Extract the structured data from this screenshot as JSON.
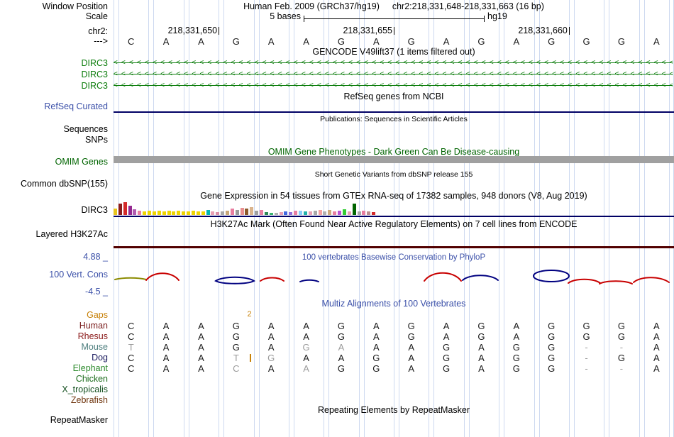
{
  "colors": {
    "guideline": "#cdd9f0",
    "gencode_green": "#0c7d0c",
    "track_blue": "#3a4fa8",
    "navy": "#000064",
    "dark_green": "#006400",
    "omim_bar": "#a0a0a0",
    "maroon_line": "#520000",
    "gaps_orange": "#c8820a",
    "cons_red": "#c80000",
    "cons_navy": "#000080",
    "cons_olive": "#8b8b00",
    "muted_letter": "#9b9b9b"
  },
  "header": {
    "window_position_label": "Window Position",
    "assembly": "Human Feb. 2009 (GRCh37/hg19)",
    "position": "chr2:218,331,648-218,331,663 (16 bp)",
    "scale_label": "Scale",
    "scale_value": "5 bases",
    "scale_assembly": "hg19",
    "chrom_label": "chr2:",
    "strand_label": "--->",
    "ruler_ticks": [
      {
        "text": "218,331,650",
        "boundary": 3
      },
      {
        "text": "218,331,655",
        "boundary": 8
      },
      {
        "text": "218,331,660",
        "boundary": 13
      }
    ],
    "sequence": [
      "C",
      "A",
      "A",
      "G",
      "A",
      "A",
      "G",
      "A",
      "G",
      "A",
      "G",
      "A",
      "G",
      "G",
      "G",
      "A"
    ]
  },
  "tracks": {
    "gencode": {
      "title": "GENCODE V49lift37 (1 items filtered out)",
      "transcripts": [
        "DIRC3",
        "DIRC3",
        "DIRC3"
      ]
    },
    "refseq": {
      "title": "RefSeq genes from NCBI",
      "label": "RefSeq Curated"
    },
    "publications": {
      "title": "Publications: Sequences in Scientific Articles",
      "labels": [
        "Sequences",
        "SNPs"
      ]
    },
    "omim": {
      "title": "OMIM Gene Phenotypes - Dark Green Can Be Disease-causing",
      "label": "OMIM Genes"
    },
    "dbsnp": {
      "title": "Short Genetic Variants from dbSNP release 155",
      "label": "Common dbSNP(155)"
    },
    "gtex": {
      "title": "Gene Expression in 54 tissues from GTEx RNA-seq of 17382 samples, 948 donors (V8, Aug 2019)",
      "label": "DIRC3",
      "bars": [
        [
          "#e8c41f",
          9
        ],
        [
          "#8b1c1c",
          16
        ],
        [
          "#d42a2a",
          18
        ],
        [
          "#94288f",
          13
        ],
        [
          "#b05bb0",
          8
        ],
        [
          "#e87ea0",
          6
        ],
        [
          "#efd500",
          5
        ],
        [
          "#efd500",
          6
        ],
        [
          "#efd500",
          5
        ],
        [
          "#efd500",
          6
        ],
        [
          "#efd500",
          5
        ],
        [
          "#efd500",
          6
        ],
        [
          "#efd500",
          5
        ],
        [
          "#efd500",
          6
        ],
        [
          "#efd500",
          5
        ],
        [
          "#efd500",
          5
        ],
        [
          "#efd500",
          6
        ],
        [
          "#efd500",
          5
        ],
        [
          "#efd500",
          5
        ],
        [
          "#00b5b5",
          7
        ],
        [
          "#e8a0b4",
          5
        ],
        [
          "#d98ea6",
          4
        ],
        [
          "#a8a8a8",
          5
        ],
        [
          "#c8a878",
          6
        ],
        [
          "#e87ea0",
          9
        ],
        [
          "#9a9a9a",
          7
        ],
        [
          "#e89090",
          10
        ],
        [
          "#8b5a2b",
          9
        ],
        [
          "#d9b38c",
          11
        ],
        [
          "#a0a0a0",
          6
        ],
        [
          "#e87ea0",
          7
        ],
        [
          "#2e8b57",
          4
        ],
        [
          "#3cb371",
          3
        ],
        [
          "#b0b0b0",
          3
        ],
        [
          "#e8a0b4",
          4
        ],
        [
          "#4169e1",
          5
        ],
        [
          "#9370db",
          4
        ],
        [
          "#e87ea0",
          6
        ],
        [
          "#87cefa",
          6
        ],
        [
          "#20b2aa",
          5
        ],
        [
          "#e8a0b4",
          5
        ],
        [
          "#a8a8a8",
          6
        ],
        [
          "#f4a0a0",
          7
        ],
        [
          "#b0b0b0",
          5
        ],
        [
          "#cdaa7d",
          7
        ],
        [
          "#e87ea0",
          5
        ],
        [
          "#ba55d3",
          6
        ],
        [
          "#32cd32",
          8
        ],
        [
          "#e8a0b4",
          5
        ],
        [
          "#006400",
          16
        ],
        [
          "#a8a8a8",
          5
        ],
        [
          "#e87ea0",
          6
        ],
        [
          "#bc8f8f",
          5
        ],
        [
          "#d42a2a",
          4
        ]
      ]
    },
    "h3k27ac": {
      "title": "H3K27Ac Mark (Often Found Near Active Regulatory Elements) on 7 cell lines from ENCODE",
      "label": "Layered H3K27Ac"
    },
    "conservation": {
      "title": "100 vertebrates Basewise Conservation by PhyloP",
      "label": "100 Vert. Cons",
      "max_label": "4.88 _",
      "min_label": "-4.5 _"
    },
    "multiz": {
      "title": "Multiz Alignments of 100 Vertebrates",
      "gaps": {
        "label": "Gaps",
        "items": [
          {
            "boundary": 4,
            "text": "2"
          }
        ]
      },
      "species": [
        {
          "name": "Human",
          "color": "#7c2020",
          "cells": [
            "C",
            "A",
            "A",
            "G",
            "A",
            "A",
            "G",
            "A",
            "G",
            "A",
            "G",
            "A",
            "G",
            "G",
            "G",
            "A"
          ],
          "muted": []
        },
        {
          "name": "Rhesus",
          "color": "#8b1a1a",
          "cells": [
            "C",
            "A",
            "A",
            "G",
            "A",
            "A",
            "G",
            "A",
            "G",
            "A",
            "G",
            "A",
            "G",
            "G",
            "G",
            "A"
          ],
          "muted": []
        },
        {
          "name": "Mouse",
          "color": "#4d7e7e",
          "cells": [
            "T",
            "A",
            "A",
            "G",
            "A",
            "G",
            "A",
            "A",
            "A",
            "G",
            "A",
            "G",
            "G",
            "-",
            "-",
            "A"
          ],
          "muted": [
            0,
            5,
            6,
            13,
            14
          ]
        },
        {
          "name": "Dog",
          "color": "#1a1a5e",
          "cells": [
            "C",
            "A",
            "A",
            "T",
            "G",
            "A",
            "A",
            "G",
            "A",
            "G",
            "A",
            "G",
            "G",
            "-",
            "G",
            "A"
          ],
          "muted": [
            3,
            4,
            13
          ],
          "insert_boundary": 4
        },
        {
          "name": "Elephant",
          "color": "#2e8b2e",
          "cells": [
            "C",
            "A",
            "A",
            "C",
            "A",
            "A",
            "G",
            "G",
            "A",
            "G",
            "A",
            "G",
            "G",
            "-",
            "-",
            "A"
          ],
          "muted": [
            3,
            5,
            13,
            14
          ]
        },
        {
          "name": "Chicken",
          "color": "#1a6b1a",
          "cells": [],
          "muted": []
        },
        {
          "name": "X_tropicalis",
          "color": "#14501f",
          "cells": [],
          "muted": []
        },
        {
          "name": "Zebrafish",
          "color": "#703710",
          "cells": [],
          "muted": []
        }
      ]
    },
    "repeatmasker": {
      "title": "Repeating Elements by RepeatMasker",
      "label": "RepeatMasker"
    }
  }
}
